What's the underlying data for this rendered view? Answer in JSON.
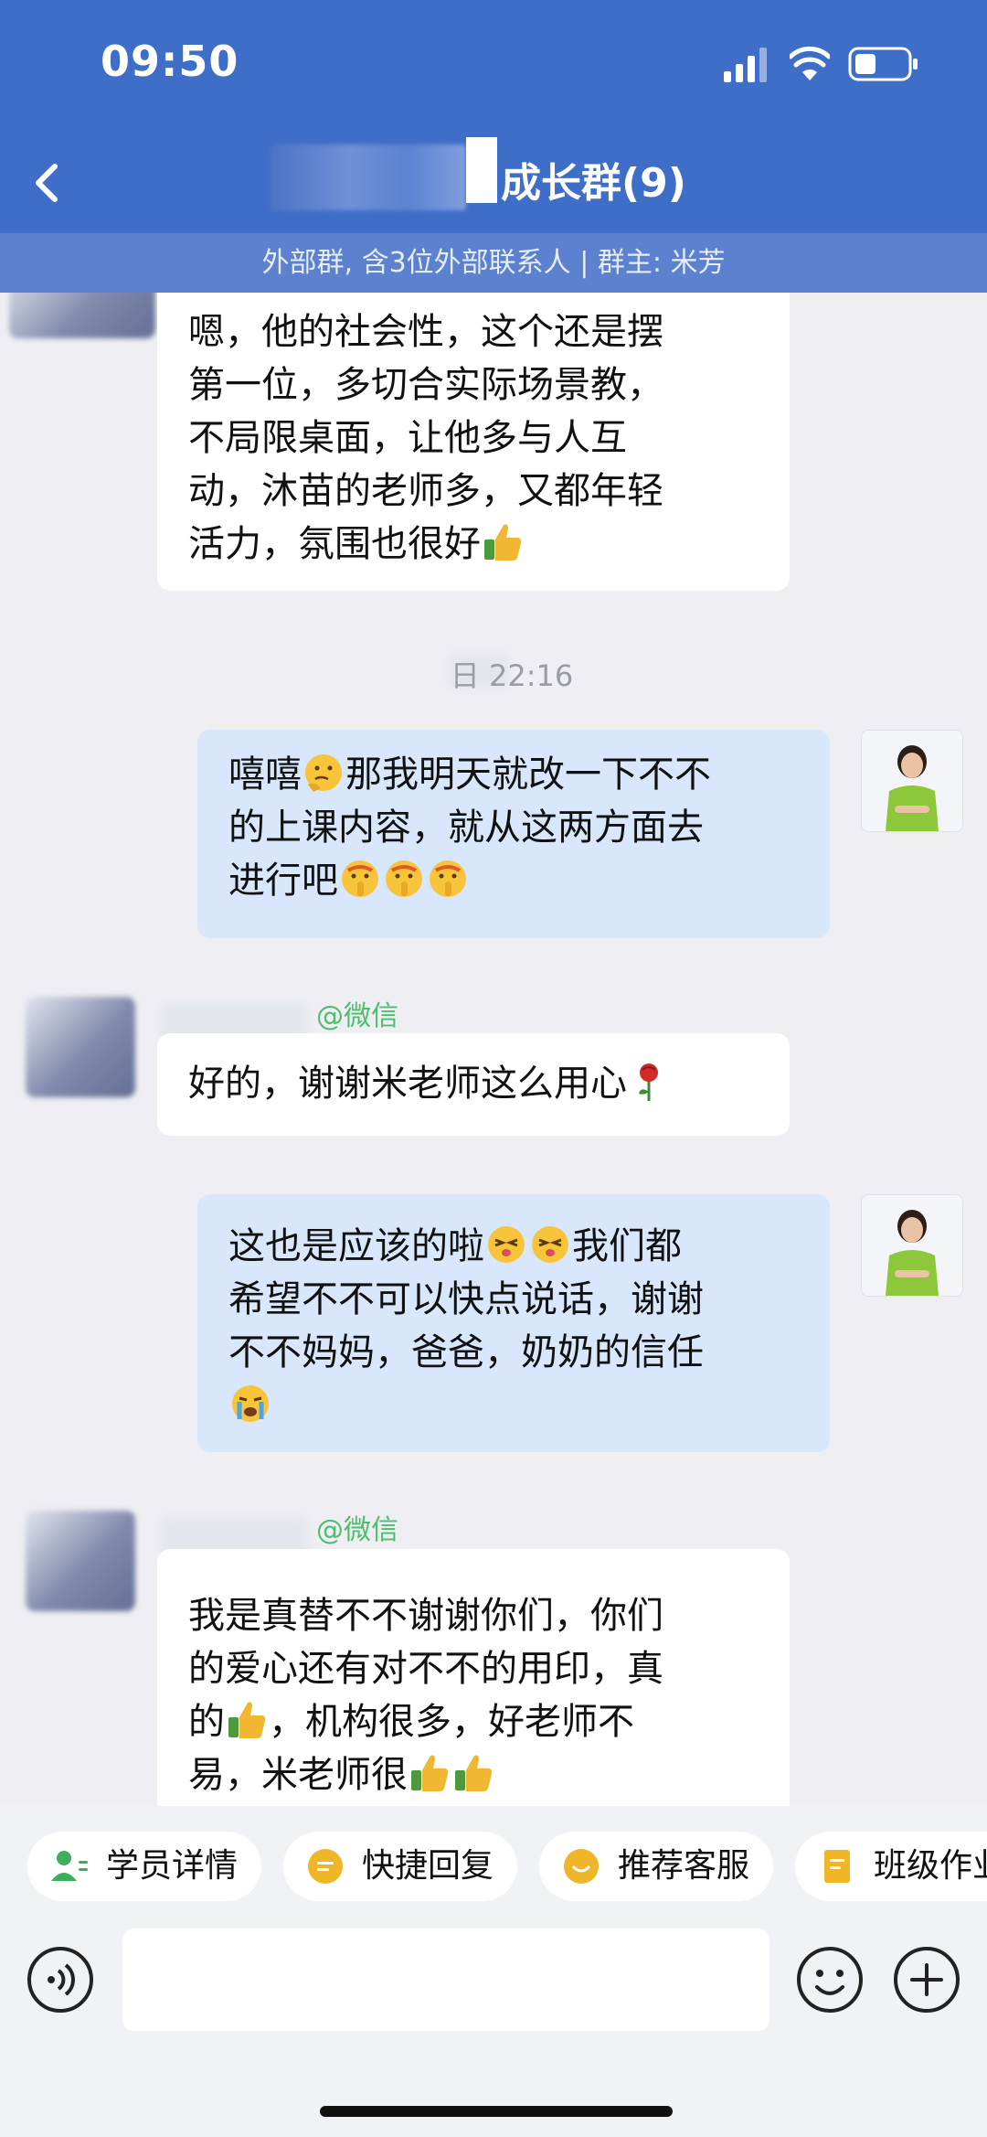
{
  "status_bar": {
    "time": "09:50"
  },
  "header": {
    "title": "成长群(9)",
    "subtitle": "外部群, 含3位外部联系人 | 群主: 米芳"
  },
  "messages": [
    {
      "direction": "incoming",
      "lines": [
        "嗯，他的社会性，这个还是摆",
        "第一位，多切合实际场景教，",
        "不局限桌面，让他多与人互",
        "动，沐苗的老师多，又都年轻",
        "活力，氛围也很好"
      ],
      "trailing_emoji": "thumbs-up"
    },
    {
      "timestamp": "日 22:16"
    },
    {
      "direction": "outgoing",
      "lines": [
        "嘻嘻",
        "那我明天就改一下不不",
        "的上课内容，就从这两方面去",
        "进行吧"
      ]
    },
    {
      "sender_tag": "@微信",
      "direction": "incoming",
      "lines": [
        "好的，谢谢米老师这么用心"
      ],
      "trailing_emoji": "rose"
    },
    {
      "direction": "outgoing",
      "lines": [
        "这也是应该的啦",
        "我们都",
        "希望不不可以快点说话，谢谢",
        "不不妈妈，爸爸，奶奶的信任"
      ]
    },
    {
      "sender_tag": "@微信",
      "direction": "incoming",
      "lines": [
        "我是真替不不谢谢你们，你们",
        "的爱心还有对不不的用印，真",
        "的",
        "，机构很多，好老师不",
        "易，米老师很"
      ]
    }
  ],
  "quick_actions": [
    "学员详情",
    "快捷回复",
    "推荐客服",
    "班级作业"
  ],
  "input": {
    "placeholder": ""
  },
  "colors": {
    "header_bg": "#3f6ec8",
    "outgoing_bubble": "#d8e7fb",
    "incoming_bubble": "#ffffff",
    "wechat_tag": "#4cbf6c"
  }
}
